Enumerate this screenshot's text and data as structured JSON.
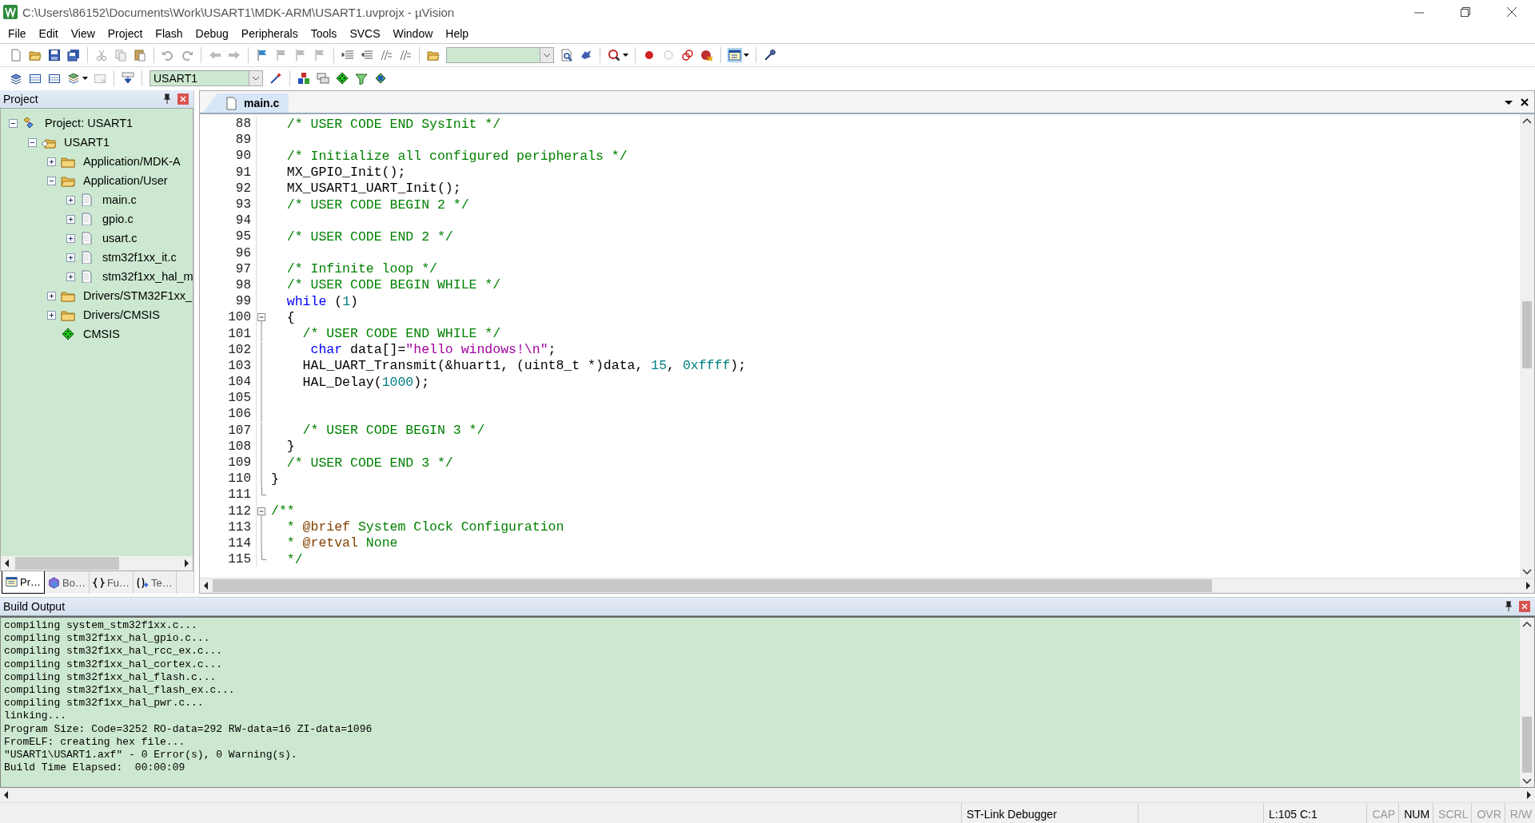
{
  "window": {
    "title": "C:\\Users\\86152\\Documents\\Work\\USART1\\MDK-ARM\\USART1.uvprojx - µVision"
  },
  "menu": [
    "File",
    "Edit",
    "View",
    "Project",
    "Flash",
    "Debug",
    "Peripherals",
    "Tools",
    "SVCS",
    "Window",
    "Help"
  ],
  "toolbar": {
    "target": "USART1"
  },
  "project": {
    "title": "Project",
    "tree": [
      {
        "label": "Project: USART1",
        "kind": "project",
        "expanded": true,
        "children": [
          {
            "label": "USART1",
            "kind": "target",
            "expanded": true,
            "children": [
              {
                "label": "Application/MDK-A",
                "kind": "folder",
                "expanded": false
              },
              {
                "label": "Application/User",
                "kind": "folder",
                "expanded": true,
                "children": [
                  {
                    "label": "main.c",
                    "kind": "file",
                    "expanded": false
                  },
                  {
                    "label": "gpio.c",
                    "kind": "file",
                    "expanded": false
                  },
                  {
                    "label": "usart.c",
                    "kind": "file",
                    "expanded": false
                  },
                  {
                    "label": "stm32f1xx_it.c",
                    "kind": "file",
                    "expanded": false
                  },
                  {
                    "label": "stm32f1xx_hal_m",
                    "kind": "file",
                    "expanded": false
                  }
                ]
              },
              {
                "label": "Drivers/STM32F1xx_",
                "kind": "folder",
                "expanded": false
              },
              {
                "label": "Drivers/CMSIS",
                "kind": "folder",
                "expanded": false
              },
              {
                "label": "CMSIS",
                "kind": "component"
              }
            ]
          }
        ]
      }
    ],
    "tabs": [
      {
        "label": "Pr…",
        "kind": "project",
        "selected": true
      },
      {
        "label": "Bo…",
        "kind": "books",
        "selected": false
      },
      {
        "label": "Fu…",
        "kind": "functions",
        "selected": false
      },
      {
        "label": "Te…",
        "kind": "templates",
        "selected": false
      }
    ]
  },
  "editor": {
    "tabs": [
      {
        "label": "main.c",
        "selected": true
      }
    ],
    "lines": [
      {
        "number": "88",
        "tokens": [
          {
            "kind": "comment",
            "text": "  /* USER CODE END SysInit */"
          }
        ]
      },
      {
        "number": "89"
      },
      {
        "number": "90",
        "tokens": [
          {
            "kind": "comment",
            "text": "  /* Initialize all configured peripherals */"
          }
        ]
      },
      {
        "number": "91",
        "tokens": [
          {
            "kind": "plain",
            "text": "  MX_GPIO_Init();"
          }
        ]
      },
      {
        "number": "92",
        "tokens": [
          {
            "kind": "plain",
            "text": "  MX_USART1_UART_Init();"
          }
        ]
      },
      {
        "number": "93",
        "tokens": [
          {
            "kind": "comment",
            "text": "  /* USER CODE BEGIN 2 */"
          }
        ]
      },
      {
        "number": "94"
      },
      {
        "number": "95",
        "tokens": [
          {
            "kind": "comment",
            "text": "  /* USER CODE END 2 */"
          }
        ]
      },
      {
        "number": "96"
      },
      {
        "number": "97",
        "tokens": [
          {
            "kind": "comment",
            "text": "  /* Infinite loop */"
          }
        ]
      },
      {
        "number": "98",
        "tokens": [
          {
            "kind": "comment",
            "text": "  /* USER CODE BEGIN WHILE */"
          }
        ]
      },
      {
        "number": "99",
        "tokens": [
          {
            "kind": "keyword",
            "text": "  while"
          },
          {
            "kind": "plain",
            "text": " ("
          },
          {
            "kind": "number",
            "text": "1"
          },
          {
            "kind": "plain",
            "text": ")"
          }
        ]
      },
      {
        "number": "100",
        "foldable": true,
        "tokens": [
          {
            "kind": "plain",
            "text": "  {"
          }
        ]
      },
      {
        "number": "101",
        "tokens": [
          {
            "kind": "comment",
            "text": "    /* USER CODE END WHILE */"
          }
        ]
      },
      {
        "number": "102",
        "tokens": [
          {
            "kind": "keyword",
            "text": "     char"
          },
          {
            "kind": "plain",
            "text": " data[]="
          },
          {
            "kind": "string",
            "text": "\"hello windows!\\n\""
          },
          {
            "kind": "plain",
            "text": ";"
          }
        ]
      },
      {
        "number": "103",
        "tokens": [
          {
            "kind": "plain",
            "text": "    HAL_UART_Transmit(&huart1, (uint8_t *)data, "
          },
          {
            "kind": "number",
            "text": "15"
          },
          {
            "kind": "plain",
            "text": ", "
          },
          {
            "kind": "number",
            "text": "0xffff"
          },
          {
            "kind": "plain",
            "text": ");"
          }
        ]
      },
      {
        "number": "104",
        "tokens": [
          {
            "kind": "plain",
            "text": "    HAL_Delay("
          },
          {
            "kind": "number",
            "text": "1000"
          },
          {
            "kind": "plain",
            "text": ");"
          }
        ]
      },
      {
        "number": "105"
      },
      {
        "number": "106"
      },
      {
        "number": "107",
        "tokens": [
          {
            "kind": "comment",
            "text": "    /* USER CODE BEGIN 3 */"
          }
        ]
      },
      {
        "number": "108",
        "tokens": [
          {
            "kind": "plain",
            "text": "  }"
          }
        ]
      },
      {
        "number": "109",
        "tokens": [
          {
            "kind": "comment",
            "text": "  /* USER CODE END 3 */"
          }
        ]
      },
      {
        "number": "110",
        "tokens": [
          {
            "kind": "plain",
            "text": "}"
          }
        ]
      },
      {
        "number": "111",
        "fold_end": true
      },
      {
        "number": "112",
        "foldable": true,
        "tokens": [
          {
            "kind": "comment",
            "text": "/**"
          }
        ]
      },
      {
        "number": "113",
        "tokens": [
          {
            "kind": "comment",
            "text": "  * "
          },
          {
            "kind": "doctag",
            "text": "@brief"
          },
          {
            "kind": "comment",
            "text": " System Clock Configuration"
          }
        ]
      },
      {
        "number": "114",
        "tokens": [
          {
            "kind": "comment",
            "text": "  * "
          },
          {
            "kind": "doctag",
            "text": "@retval"
          },
          {
            "kind": "comment",
            "text": " None"
          }
        ]
      },
      {
        "number": "115",
        "fold_end": true,
        "tokens": [
          {
            "kind": "comment",
            "text": "  */"
          }
        ]
      }
    ]
  },
  "build_output": {
    "title": "Build Output",
    "lines": [
      "compiling system_stm32f1xx.c...",
      "compiling stm32f1xx_hal_gpio.c...",
      "compiling stm32f1xx_hal_rcc_ex.c...",
      "compiling stm32f1xx_hal_cortex.c...",
      "compiling stm32f1xx_hal_flash.c...",
      "compiling stm32f1xx_hal_flash_ex.c...",
      "compiling stm32f1xx_hal_pwr.c...",
      "linking...",
      "Program Size: Code=3252 RO-data=292 RW-data=16 ZI-data=1096",
      "FromELF: creating hex file...",
      "\"USART1\\USART1.axf\" - 0 Error(s), 0 Warning(s).",
      "Build Time Elapsed:  00:00:09"
    ]
  },
  "status_bar": {
    "debugger": "ST-Link Debugger",
    "position": "L:105 C:1",
    "indicators": [
      {
        "label": "CAP",
        "on": false
      },
      {
        "label": "NUM",
        "on": true
      },
      {
        "label": "SCRL",
        "on": false
      },
      {
        "label": "OVR",
        "on": false
      },
      {
        "label": "R/W",
        "on": false
      }
    ]
  }
}
